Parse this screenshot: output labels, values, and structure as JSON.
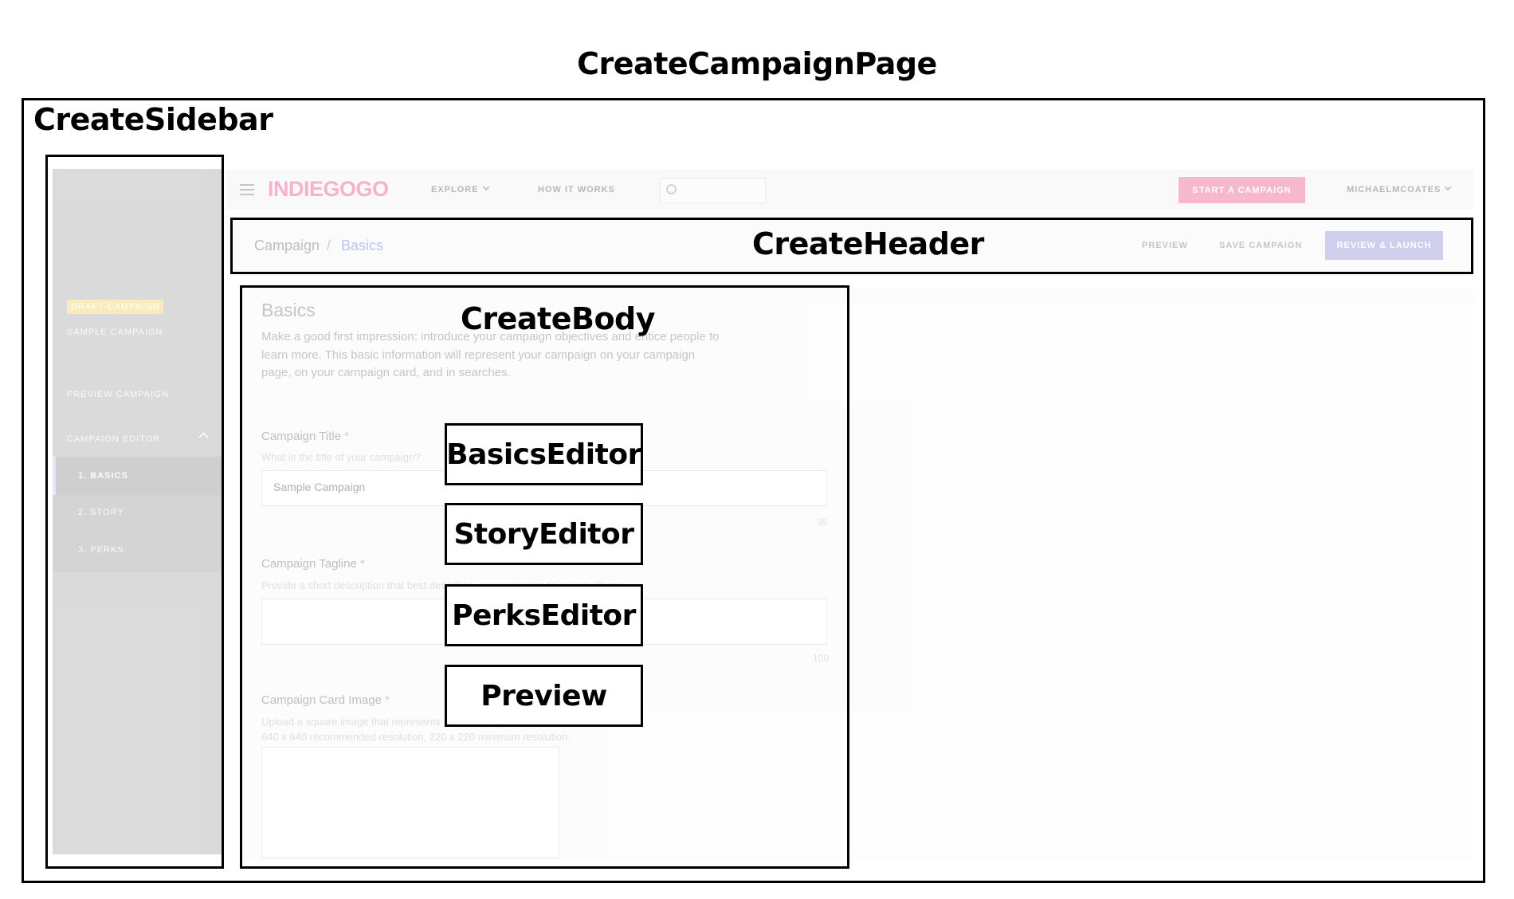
{
  "diagram": {
    "page_label": "CreateCampaignPage",
    "sidebar_label": "CreateSidebar",
    "header_label": "CreateHeader",
    "body_label": "CreateBody",
    "children": [
      "BasicsEditor",
      "StoryEditor",
      "PerksEditor",
      "Preview"
    ]
  },
  "ui": {
    "sidebar": {
      "badge": "DRAFT CAMPAIGN",
      "campaign_name": "SAMPLE CAMPAIGN",
      "preview_link": "PREVIEW CAMPAIGN",
      "editor_section": "CAMPAIGN EDITOR",
      "steps": [
        "1. BASICS",
        "2. STORY",
        "3. PERKS"
      ]
    },
    "topnav": {
      "logo": "INDIEGOGO",
      "explore": "EXPLORE",
      "how_it_works": "HOW IT WORKS",
      "start_button": "START A CAMPAIGN",
      "user": "MICHAELMCOATES"
    },
    "header": {
      "crumb_root": "Campaign",
      "crumb_sep": "/",
      "crumb_current": "Basics",
      "preview": "PREVIEW",
      "save": "SAVE CAMPAIGN",
      "review": "REVIEW & LAUNCH"
    },
    "body": {
      "title": "Basics",
      "description": "Make a good first impression: introduce your campaign objectives and entice people to learn more. This basic information will represent your campaign on your campaign page, on your campaign card, and in searches.",
      "fields": {
        "title_label": "Campaign Title",
        "title_help": "What is the title of your campaign?",
        "title_value": "Sample Campaign",
        "title_counter": "35",
        "tagline_label": "Campaign Tagline",
        "tagline_help": "Provide a short description that best describes your campaign to your audience.",
        "tagline_counter": "100",
        "image_label": "Campaign Card Image",
        "image_help_1": "Upload a square image that represents your campaign.",
        "image_help_2": "640 x 640 recommended resolution, 220 x 220 minimum resolution.",
        "required_mark": "*"
      }
    }
  },
  "colors": {
    "brand": "#e84a8a",
    "accent": "#5b78d6",
    "badge": "#f5d060"
  }
}
